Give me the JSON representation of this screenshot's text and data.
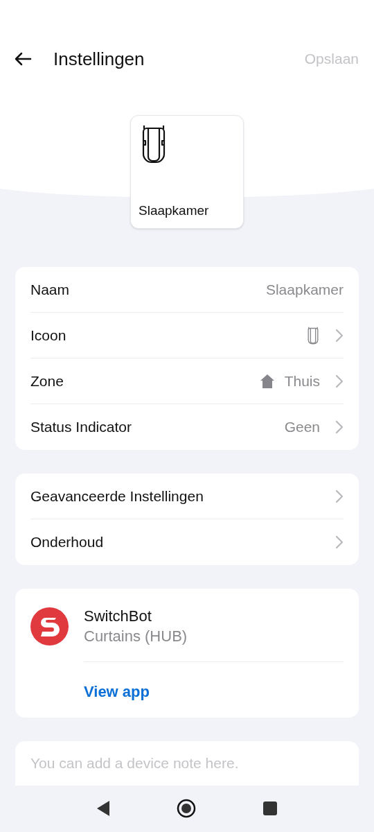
{
  "header": {
    "title": "Instellingen",
    "save": {
      "label": "Opslaan",
      "disabled": true
    }
  },
  "device_tile": {
    "label": "Slaapkamer"
  },
  "settings_groups": [
    {
      "rows": [
        {
          "label": "Naam",
          "kind": "text",
          "value": "Slaapkamer"
        },
        {
          "label": "Icoon",
          "kind": "icon"
        },
        {
          "label": "Zone",
          "kind": "zone",
          "value": "Thuis"
        },
        {
          "label": "Status Indicator",
          "kind": "link",
          "value": "Geen"
        }
      ]
    },
    {
      "rows": [
        {
          "label": "Geavanceerde Instellingen",
          "kind": "link"
        },
        {
          "label": "Onderhoud",
          "kind": "link"
        }
      ]
    }
  ],
  "integration": {
    "name": "SwitchBot",
    "subtitle": "Curtains (HUB)",
    "link": "View app"
  },
  "note": {
    "placeholder": "You can add a device note here."
  }
}
